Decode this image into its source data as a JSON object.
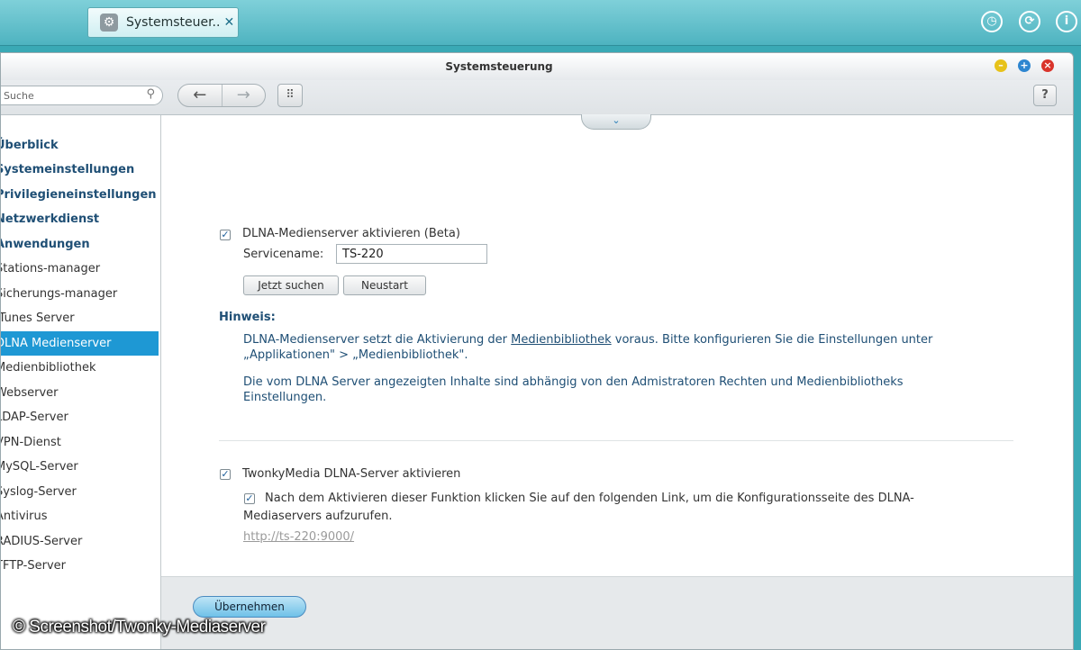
{
  "taskbar": {
    "tab_label": "Systemsteuer..",
    "tab_icon": "gear-icon",
    "buttons": [
      "clock-icon",
      "sync-icon",
      "info-icon"
    ]
  },
  "window": {
    "title": "Systemsteuerung",
    "controls": {
      "minimize_color": "#e7c21a",
      "maximize_color": "#2e86d0",
      "close_color": "#d9342b"
    }
  },
  "toolbar": {
    "search_placeholder": "Suche",
    "help_label": "?"
  },
  "sidebar": {
    "items": [
      {
        "label": "Überblick",
        "type": "category"
      },
      {
        "label": "Systemeinstellungen",
        "type": "category"
      },
      {
        "label": "Privilegieneinstellungen",
        "type": "category"
      },
      {
        "label": "Netzwerkdienst",
        "type": "category"
      },
      {
        "label": "Anwendungen",
        "type": "category"
      },
      {
        "label": "Stations-manager",
        "type": "item"
      },
      {
        "label": "Sicherungs-manager",
        "type": "item"
      },
      {
        "label": "iTunes Server",
        "type": "item"
      },
      {
        "label": "DLNA Medienserver",
        "type": "item",
        "active": true
      },
      {
        "label": "Medienbibliothek",
        "type": "item"
      },
      {
        "label": "Webserver",
        "type": "item"
      },
      {
        "label": "LDAP-Server",
        "type": "item"
      },
      {
        "label": "VPN-Dienst",
        "type": "item"
      },
      {
        "label": "MySQL-Server",
        "type": "item"
      },
      {
        "label": "Syslog-Server",
        "type": "item"
      },
      {
        "label": "Antivirus",
        "type": "item"
      },
      {
        "label": "RADIUS-Server",
        "type": "item"
      },
      {
        "label": "TFTP-Server",
        "type": "item"
      }
    ]
  },
  "dlna": {
    "enable_label": "DLNA-Medienserver aktivieren (Beta)",
    "enabled": true,
    "service_name_label": "Servicename:",
    "service_name_value": "TS-220",
    "search_now_label": "Jetzt suchen",
    "restart_label": "Neustart"
  },
  "hint": {
    "title": "Hinweis:",
    "line1_pre": "DLNA-Medienserver setzt die Aktivierung der ",
    "line1_link": "Medienbibliothek",
    "line1_post": " voraus. Bitte konfigurieren Sie die Einstellungen unter",
    "line2": "„Applikationen\" > „Medienbibliothek\".",
    "para2_line1": "Die vom DLNA Server angezeigten Inhalte sind abhängig von den Admistratoren Rechten und Medienbibliotheks",
    "para2_line2": "Einstellungen."
  },
  "twonky": {
    "enable_label": "TwonkyMedia DLNA-Server aktivieren",
    "enabled": true,
    "desc_checked": true,
    "desc": "Nach dem Aktivieren dieser Funktion klicken Sie auf den folgenden Link, um die Konfigurationsseite des DLNA-Mediaservers aufzurufen.",
    "link": "http://ts-220:9000/"
  },
  "footer": {
    "apply_label": "Übernehmen"
  },
  "watermark": "© Screenshot/Twonky-Mediaserver"
}
